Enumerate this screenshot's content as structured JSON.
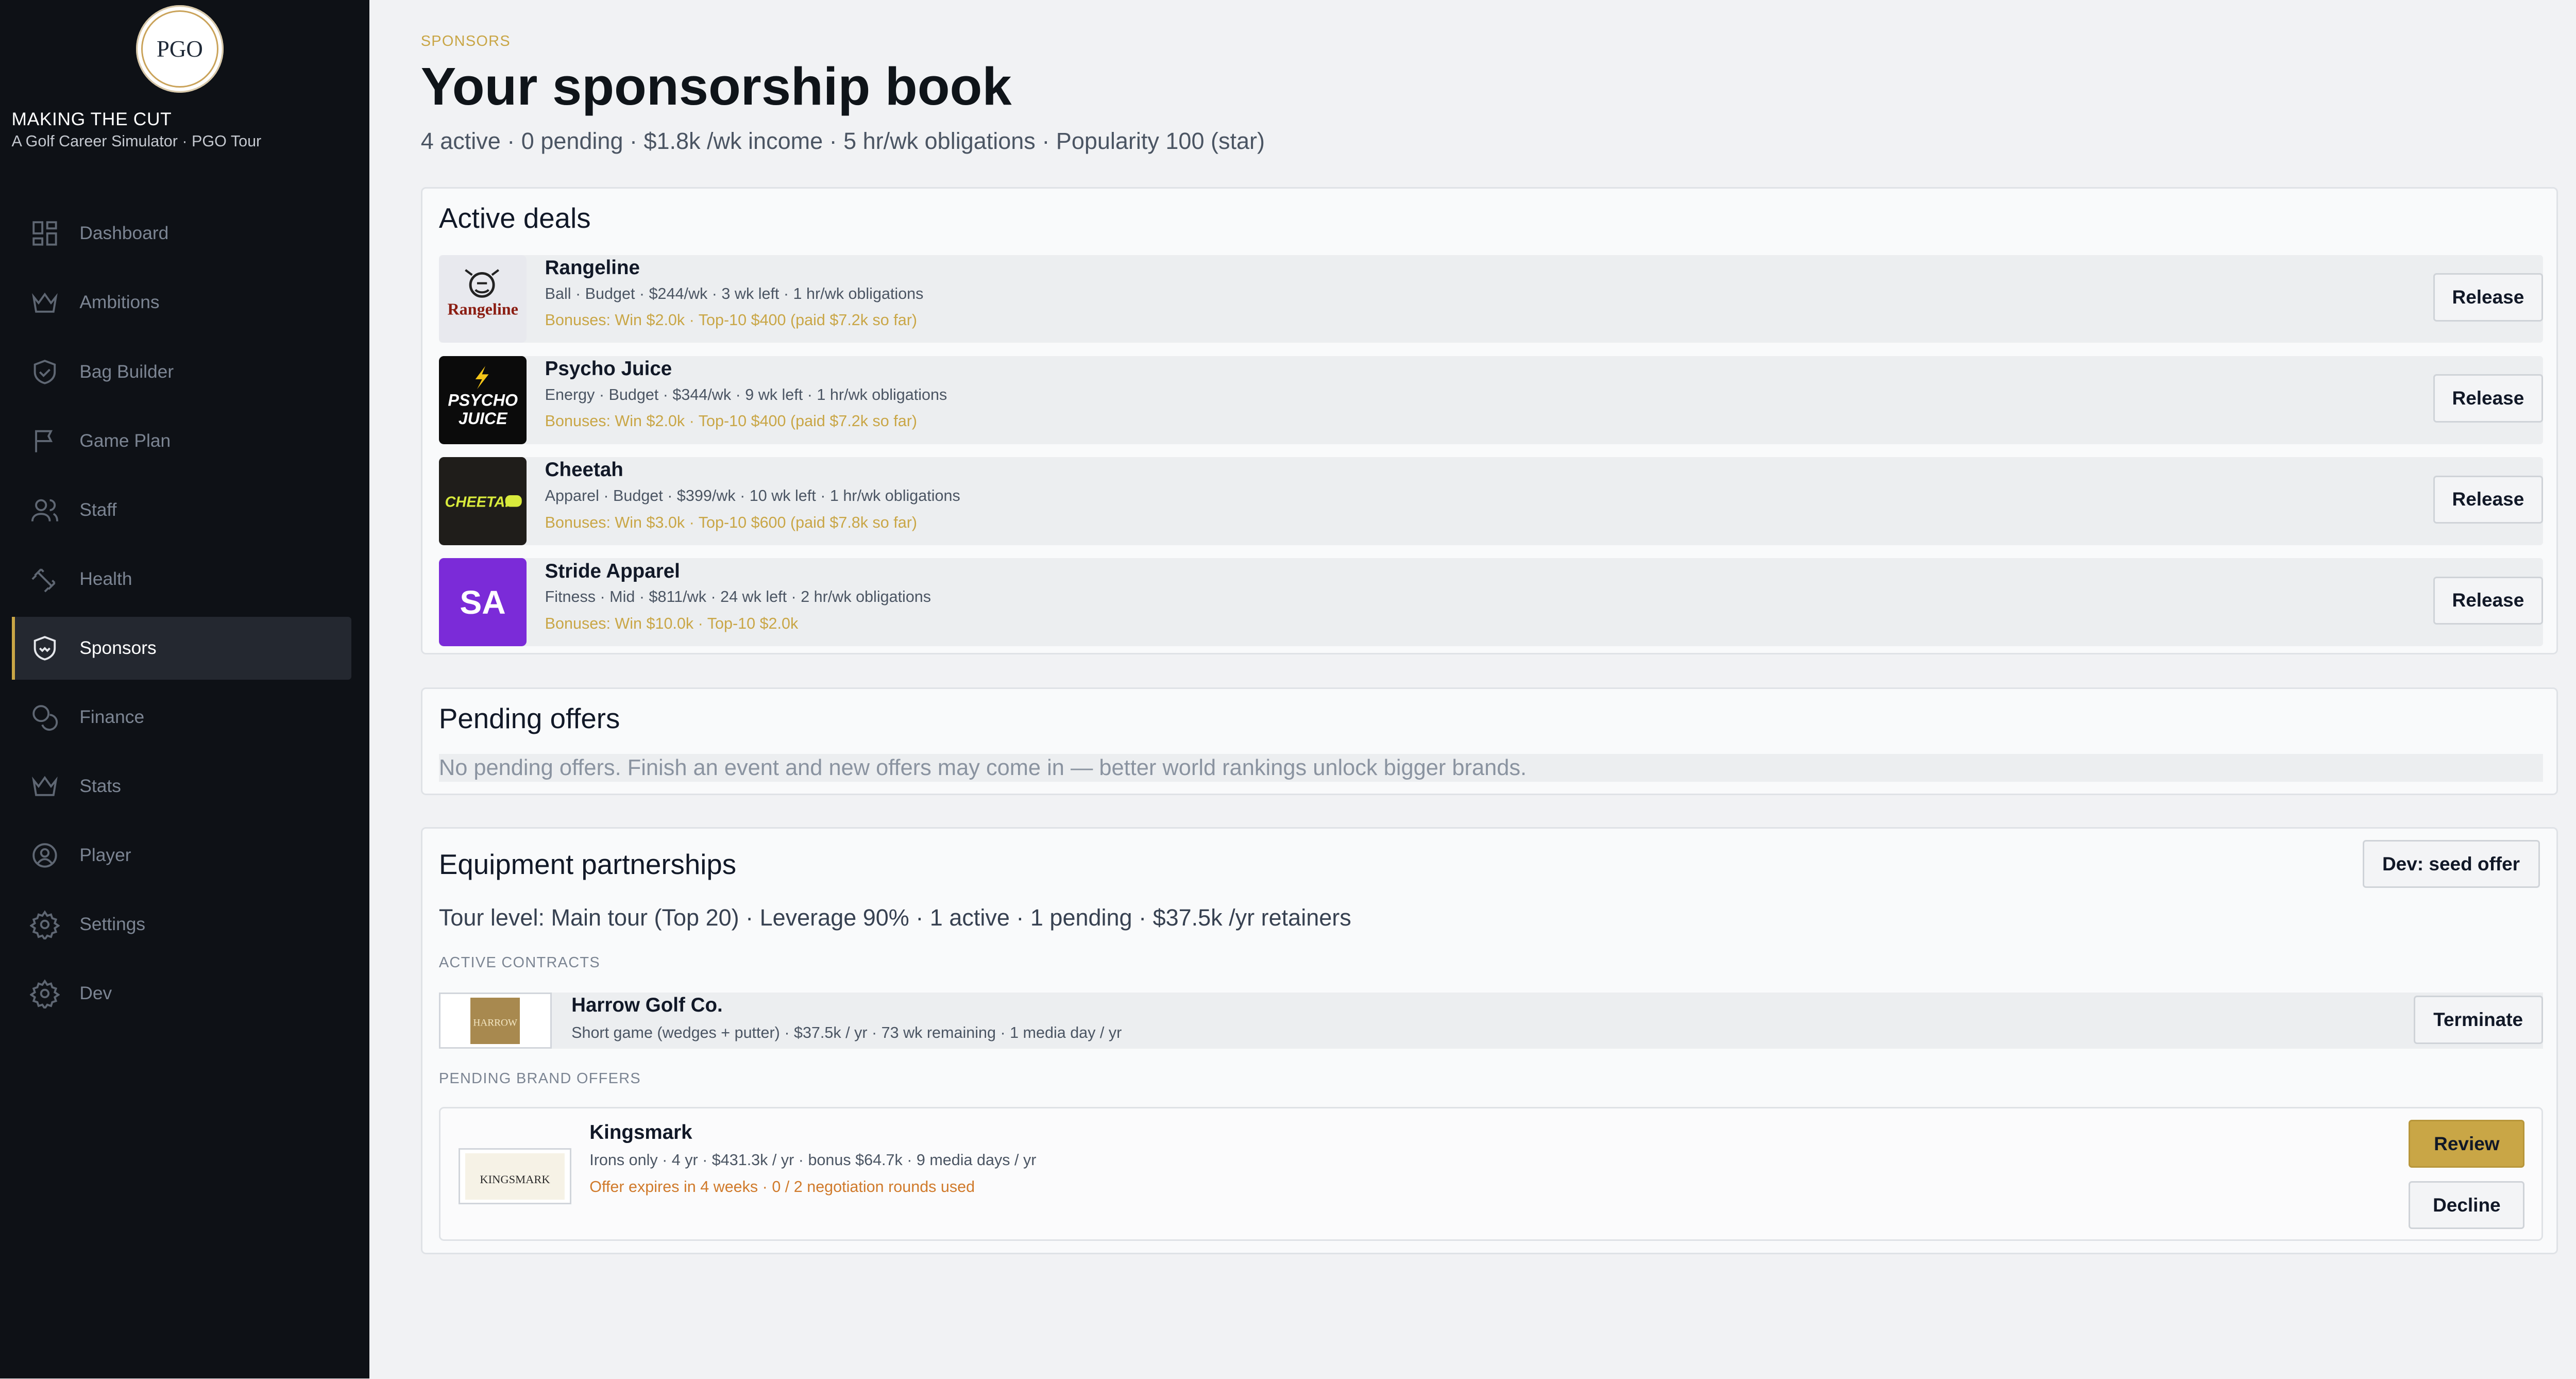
{
  "app": {
    "logo_text": "PGO",
    "title": "MAKING THE CUT",
    "subtitle": "A Golf Career Simulator · PGO Tour"
  },
  "nav": [
    {
      "label": "Dashboard",
      "icon": "dashboard-icon"
    },
    {
      "label": "Ambitions",
      "icon": "crown-icon"
    },
    {
      "label": "Bag Builder",
      "icon": "shield-icon"
    },
    {
      "label": "Game Plan",
      "icon": "flag-icon"
    },
    {
      "label": "Staff",
      "icon": "users-icon"
    },
    {
      "label": "Health",
      "icon": "dumbbell-icon"
    },
    {
      "label": "Sponsors",
      "icon": "handshake-icon",
      "active": true
    },
    {
      "label": "Finance",
      "icon": "coins-icon"
    },
    {
      "label": "Stats",
      "icon": "crown-icon"
    },
    {
      "label": "Player",
      "icon": "user-circle-icon"
    },
    {
      "label": "Settings",
      "icon": "gear-icon"
    },
    {
      "label": "Dev",
      "icon": "gear-icon"
    }
  ],
  "header": {
    "kicker": "SPONSORS",
    "title": "Your sponsorship book",
    "summary": "4 active · 0 pending · $1.8k /wk income · 5 hr/wk obligations · Popularity 100 (star)"
  },
  "active_deals": {
    "title": "Active deals",
    "release_label": "Release",
    "deals": [
      {
        "name": "Rangeline",
        "meta": "Ball · Budget · $244/wk · 3 wk left · 1 hr/wk obligations",
        "bonus": "Bonuses: Win $2.0k · Top-10 $400  (paid $7.2k so far)",
        "logo_text": "Rangeline"
      },
      {
        "name": "Psycho Juice",
        "meta": "Energy · Budget · $344/wk · 9 wk left · 1 hr/wk obligations",
        "bonus": "Bonuses: Win $2.0k · Top-10 $400  (paid $7.2k so far)",
        "logo_line1": "PSYCHO",
        "logo_line2": "JUICE"
      },
      {
        "name": "Cheetah",
        "meta": "Apparel · Budget · $399/wk · 10 wk left · 1 hr/wk obligations",
        "bonus": "Bonuses: Win $3.0k · Top-10 $600  (paid $7.8k so far)",
        "logo_text": "CHEETAH"
      },
      {
        "name": "Stride Apparel",
        "meta": "Fitness · Mid · $811/wk · 24 wk left · 2 hr/wk obligations",
        "bonus": "Bonuses: Win $10.0k · Top-10 $2.0k",
        "logo_text": "SA"
      }
    ]
  },
  "pending_offers": {
    "title": "Pending offers",
    "empty_text": "No pending offers. Finish an event and new offers may come in — better world rankings unlock bigger brands."
  },
  "equipment": {
    "title": "Equipment partnerships",
    "seed_label": "Dev: seed offer",
    "summary": "Tour level: Main tour (Top 20) · Leverage 90% · 1 active · 1 pending · $37.5k /yr retainers",
    "active_label": "ACTIVE CONTRACTS",
    "contract": {
      "name": "Harrow Golf Co.",
      "meta": "Short game (wedges + putter) · $37.5k / yr · 73 wk remaining · 1 media day / yr",
      "logo_text": "HARROW",
      "action": "Terminate"
    },
    "pending_label": "PENDING BRAND OFFERS",
    "offer": {
      "name": "Kingsmark",
      "meta": "Irons only · 4 yr · $431.3k / yr · bonus $64.7k · 9 media days / yr",
      "expiry": "Offer expires in 4 weeks · 0 / 2 negotiation rounds used",
      "logo_text": "KINGSMARK",
      "review": "Review",
      "decline": "Decline"
    }
  }
}
